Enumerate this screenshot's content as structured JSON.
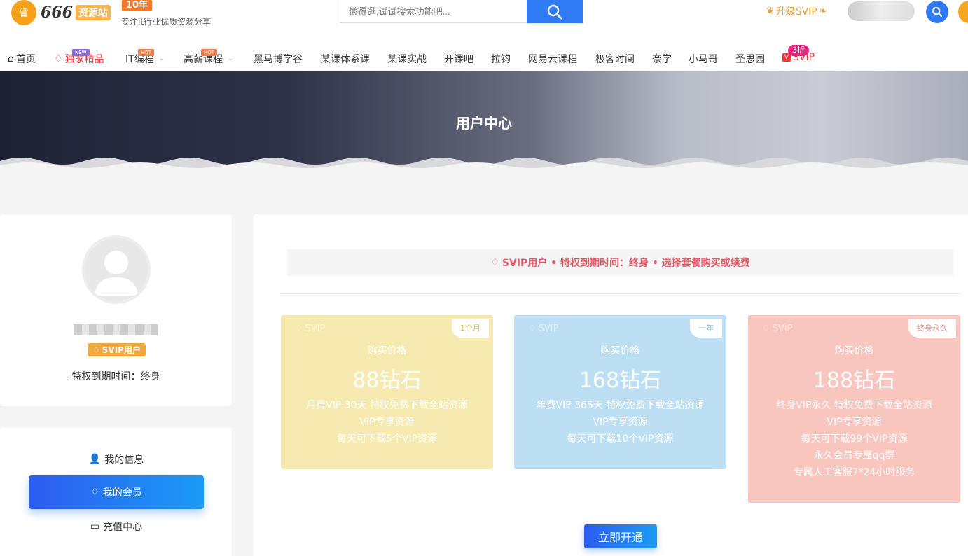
{
  "brand": {
    "logo_text": "666",
    "site_text": "资源站",
    "years_badge": "10年",
    "slogan": "专注it行业优质资源分享"
  },
  "search": {
    "placeholder": "懒得逛,试试搜索功能吧..."
  },
  "upgrade_label": "升级SVIP",
  "nav": {
    "home": "首页",
    "exclusive": "独家精品",
    "exclusive_tag": "NEW",
    "it": "IT编程",
    "it_tag": "HOT",
    "salary": "高薪课程",
    "salary_tag": "HOT",
    "heima": "黑马博学谷",
    "system": "某课体系课",
    "practice": "某课实战",
    "kaike": "开课吧",
    "lagou": "拉钩",
    "netease": "网易云课程",
    "geek": "极客时间",
    "naixue": "奈学",
    "xiaomage": "小马哥",
    "shengsi": "圣思园",
    "svip": "SVIP",
    "svip_tag": "3折"
  },
  "banner": {
    "title": "用户中心"
  },
  "profile": {
    "badge": "SVIP用户",
    "expiry": "特权到期时间：终身"
  },
  "menu": {
    "info": "我的信息",
    "member": "我的会员",
    "recharge": "充值中心"
  },
  "notice": "SVIP用户 • 特权到期时间：终身 • 选择套餐购买或续费",
  "plans": [
    {
      "label": "SVIP",
      "tag": "1个月",
      "price_label": "购买价格",
      "price": "88钻石",
      "features": [
        "月费VIP 30天 特权免费下载全站资源",
        "VIP专享资源",
        "每天可下载5个VIP资源"
      ],
      "color": "#f6eab0"
    },
    {
      "label": "SVIP",
      "tag": "一年",
      "price_label": "购买价格",
      "price": "168钻石",
      "features": [
        "年费VIP 365天 特权免费下载全站资源",
        "VIP专享资源",
        "每天可下载10个VIP资源"
      ],
      "color": "#bcdff3"
    },
    {
      "label": "SVIP",
      "tag": "终身永久",
      "price_label": "购买价格",
      "price": "188钻石",
      "features": [
        "终身VIP永久 特权免费下载全站资源",
        "VIP专享资源",
        "每天可下载99个VIP资源",
        "永久会员专属qq群",
        "专属人工客服7*24小时服务"
      ],
      "color": "#f8c6bf"
    }
  ],
  "open_button": "立即开通",
  "colors": {
    "accent": "#2f7bf5",
    "vip_gold": "#f0a83a",
    "notice_red": "#e35b6a"
  }
}
